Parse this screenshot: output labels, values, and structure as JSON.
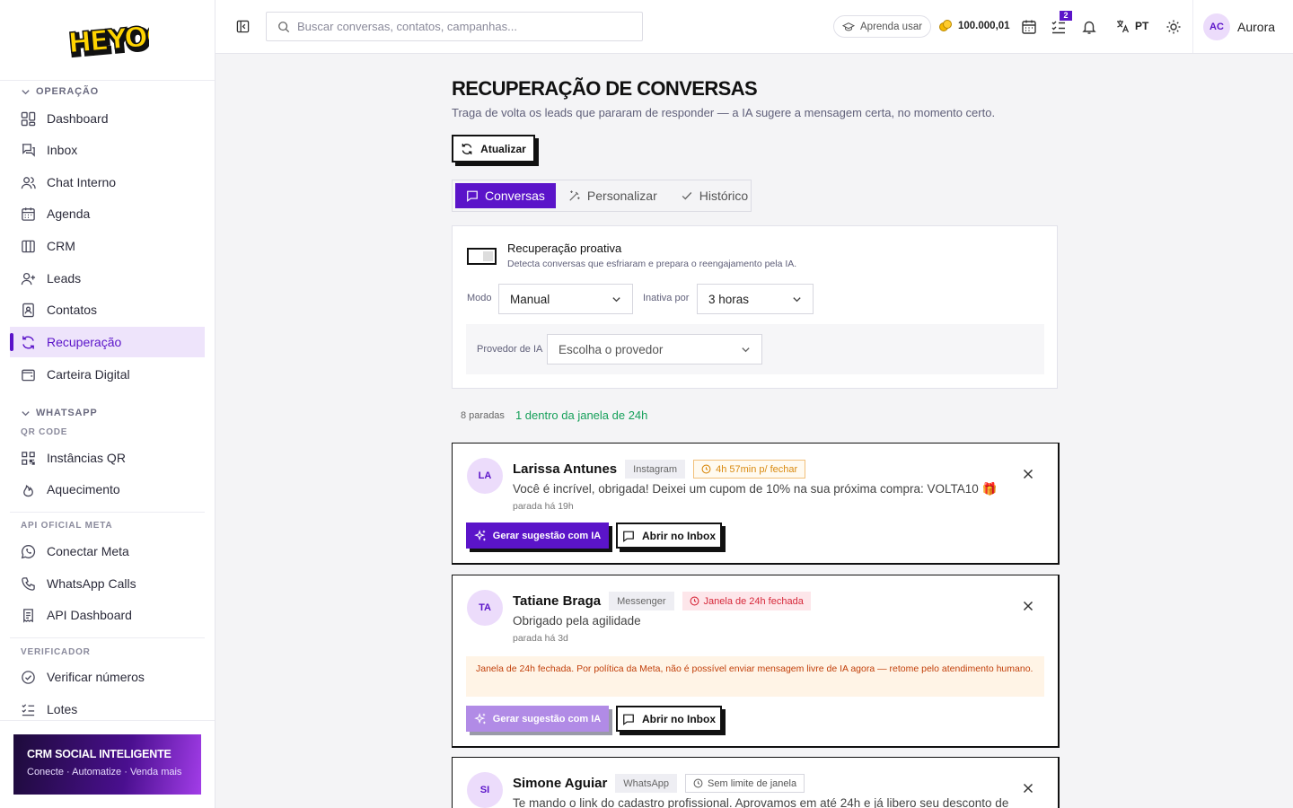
{
  "app": {
    "logo_text": "HEYOO"
  },
  "sidebar": {
    "section_operacao": "OPERAÇÃO",
    "items_operacao": [
      {
        "label": "Dashboard",
        "icon": "dashboard-icon"
      },
      {
        "label": "Inbox",
        "icon": "inbox-icon"
      },
      {
        "label": "Chat Interno",
        "icon": "users-icon"
      },
      {
        "label": "Agenda",
        "icon": "calendar-icon"
      },
      {
        "label": "CRM",
        "icon": "kanban-icon"
      },
      {
        "label": "Leads",
        "icon": "user-plus-icon"
      },
      {
        "label": "Contatos",
        "icon": "contact-book-icon"
      },
      {
        "label": "Recuperação",
        "icon": "refresh-icon",
        "active": true
      },
      {
        "label": "Carteira Digital",
        "icon": "wallet-icon"
      }
    ],
    "section_whatsapp": "WHATSAPP",
    "sub_qr": "QR CODE",
    "items_qr": [
      {
        "label": "Instâncias QR",
        "icon": "qr-code-icon"
      },
      {
        "label": "Aquecimento",
        "icon": "flame-icon"
      }
    ],
    "sub_meta": "API OFICIAL META",
    "items_meta": [
      {
        "label": "Conectar Meta",
        "icon": "whatsapp-icon"
      },
      {
        "label": "WhatsApp Calls",
        "icon": "phone-icon"
      },
      {
        "label": "API Dashboard",
        "icon": "receipt-icon"
      }
    ],
    "sub_verificador": "VERIFICADOR",
    "items_verificador": [
      {
        "label": "Verificar números",
        "icon": "check-circle-icon"
      },
      {
        "label": "Lotes",
        "icon": "list-checks-icon"
      }
    ],
    "promo": {
      "title": "CRM SOCIAL INTELIGENTE",
      "subtitle": "Conecte · Automatize · Venda mais"
    }
  },
  "topbar": {
    "search_placeholder": "Buscar conversas, contatos, campanhas...",
    "learn_label": "Aprenda usar",
    "credits": "100.000,01",
    "tasks_badge": "2",
    "language": "PT",
    "user_initials": "AC",
    "user_name": "Aurora"
  },
  "page": {
    "title": "RECUPERAÇÃO DE CONVERSAS",
    "subtitle": "Traga de volta os leads que pararam de responder — a IA sugere a mensagem certa, no momento certo.",
    "refresh_label": "Atualizar",
    "tabs": [
      "Conversas",
      "Personalizar",
      "Histórico"
    ],
    "proactive": {
      "title": "Recuperação proativa",
      "description": "Detecta conversas que esfriaram e prepara o reengajamento pela IA.",
      "enabled": false
    },
    "mode_label": "Modo",
    "mode_value": "Manual",
    "inactive_label": "Inativa por",
    "inactive_value": "3 horas",
    "provider_label": "Provedor de IA",
    "provider_placeholder": "Escolha o provedor",
    "stats_stopped": "8 paradas",
    "stats_window": "1 dentro da janela de 24h",
    "ai_button": "Gerar sugestão com IA",
    "inbox_button": "Abrir no Inbox"
  },
  "conversations": [
    {
      "initials": "LA",
      "name": "Larissa Antunes",
      "channel": "Instagram",
      "status": "4h 57min p/ fechar",
      "message": "Você é incrível, obrigada! Deixei um cupom de 10% na sua próxima compra: VOLTA10 🎁",
      "since": "parada há 19h"
    },
    {
      "initials": "TA",
      "name": "Tatiane Braga",
      "channel": "Messenger",
      "status": "Janela de 24h fechada",
      "message": "Obrigado pela agilidade",
      "since": "parada há 3d",
      "warning": "Janela de 24h fechada. Por política da Meta, não é possível enviar mensagem livre de IA agora — retome pelo atendimento humano."
    },
    {
      "initials": "SI",
      "name": "Simone Aguiar",
      "channel": "WhatsApp",
      "status": "Sem limite de janela",
      "message": "Te mando o link do cadastro profissional. Aprovamos em até 24h e já libero seu desconto de"
    }
  ],
  "colors": {
    "accent": "#5b14c9",
    "accent_light": "#eee4fb",
    "success": "#16a05a",
    "danger": "#d6283a",
    "warning": "#d98a10"
  }
}
